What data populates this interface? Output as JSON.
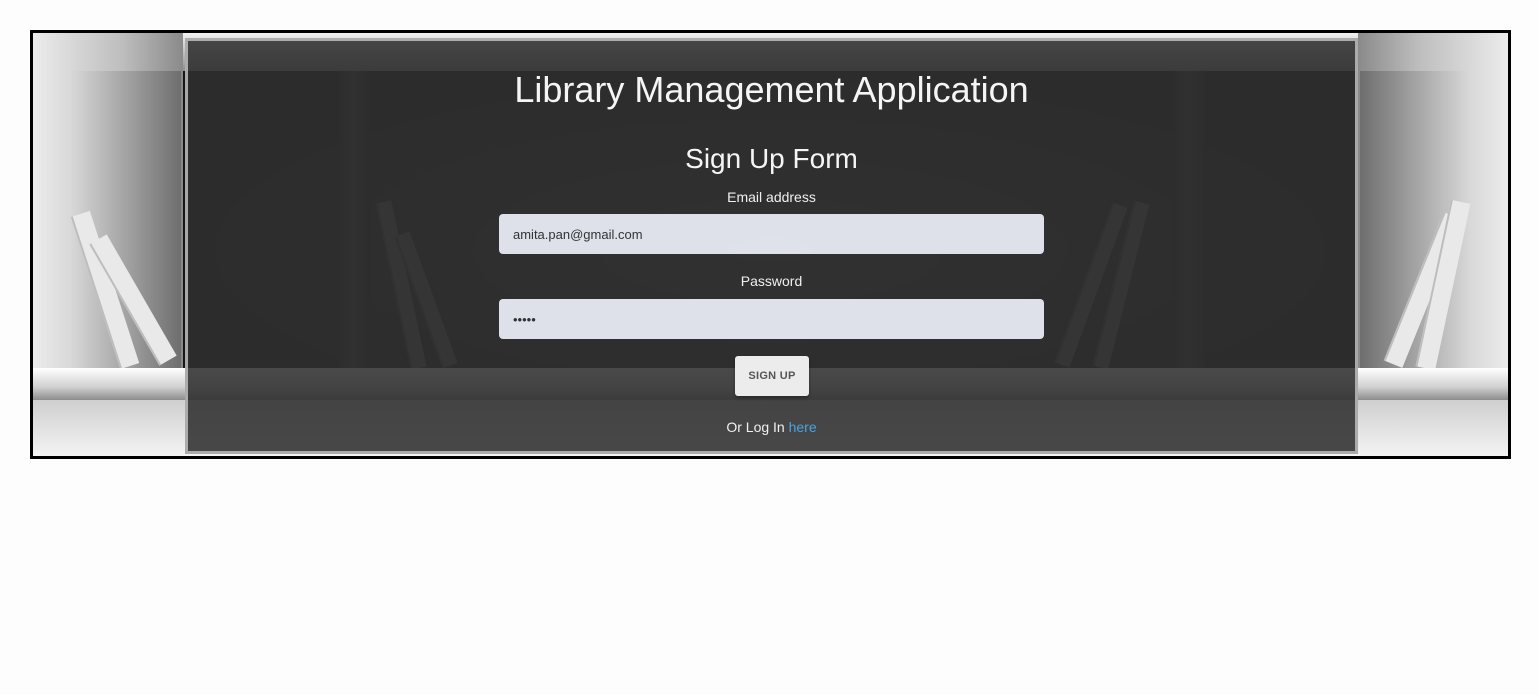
{
  "app": {
    "title": "Library Management Application"
  },
  "form": {
    "heading": "Sign Up Form",
    "email": {
      "label": "Email address",
      "value": "amita.pan@gmail.com"
    },
    "password": {
      "label": "Password",
      "value": "•••••"
    },
    "submit_label": "SIGN UP",
    "login_prompt": "Or Log In",
    "login_link": "here"
  },
  "colors": {
    "link": "#4aa3df",
    "panel": "#303030"
  }
}
